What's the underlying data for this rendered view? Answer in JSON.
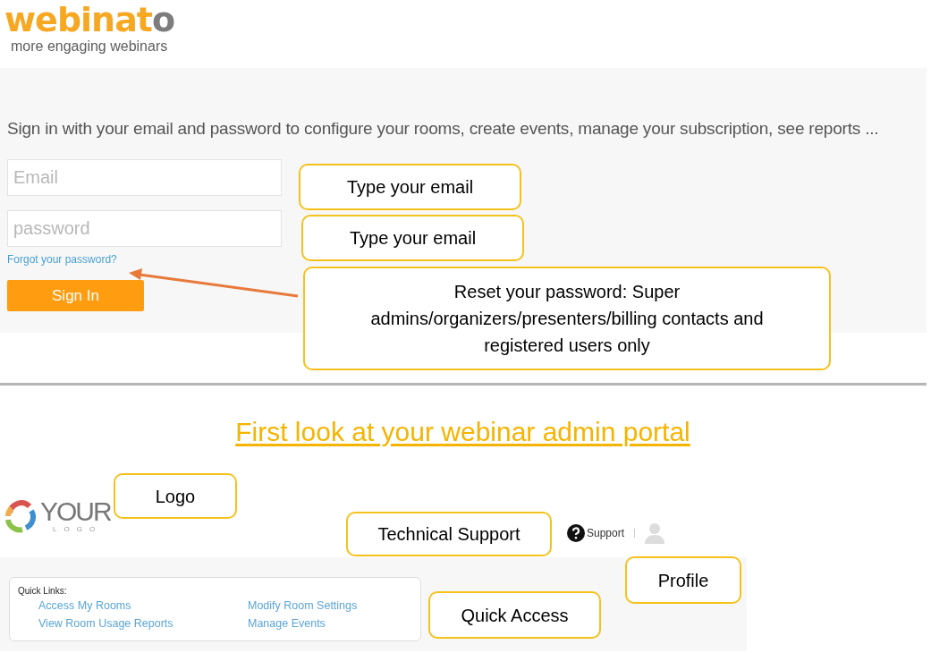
{
  "header": {
    "logo_main": "webinat",
    "logo_last": "o",
    "tagline": "more engaging webinars"
  },
  "login": {
    "intro": "Sign in with your email and password to configure your rooms, create events, manage your subscription, see reports ...",
    "email": {
      "placeholder": "Email"
    },
    "password": {
      "placeholder": "password"
    },
    "forgot_link": "Forgot your password?",
    "sign_in_button": "Sign In"
  },
  "login_callouts": [
    {
      "text": "Type your email"
    },
    {
      "text": "Type your email"
    },
    {
      "text": "Reset your password: Super admins/organizers/presenters/billing contacts and registered users only"
    }
  ],
  "section_heading": "First look at your webinar admin portal",
  "portal": {
    "logo_text": "YOUR",
    "logo_subtext": "LOGO",
    "support_link": "Support",
    "quick_links": {
      "title": "Quick Links:",
      "links": [
        {
          "label": "Access My Rooms"
        },
        {
          "label": "Modify Room Settings"
        },
        {
          "label": "View Room Usage Reports"
        },
        {
          "label": "Manage Events"
        }
      ]
    }
  },
  "portal_callouts": [
    {
      "text": "Logo"
    },
    {
      "text": "Technical Support"
    },
    {
      "text": "Profile"
    },
    {
      "text": "Quick Access"
    }
  ]
}
